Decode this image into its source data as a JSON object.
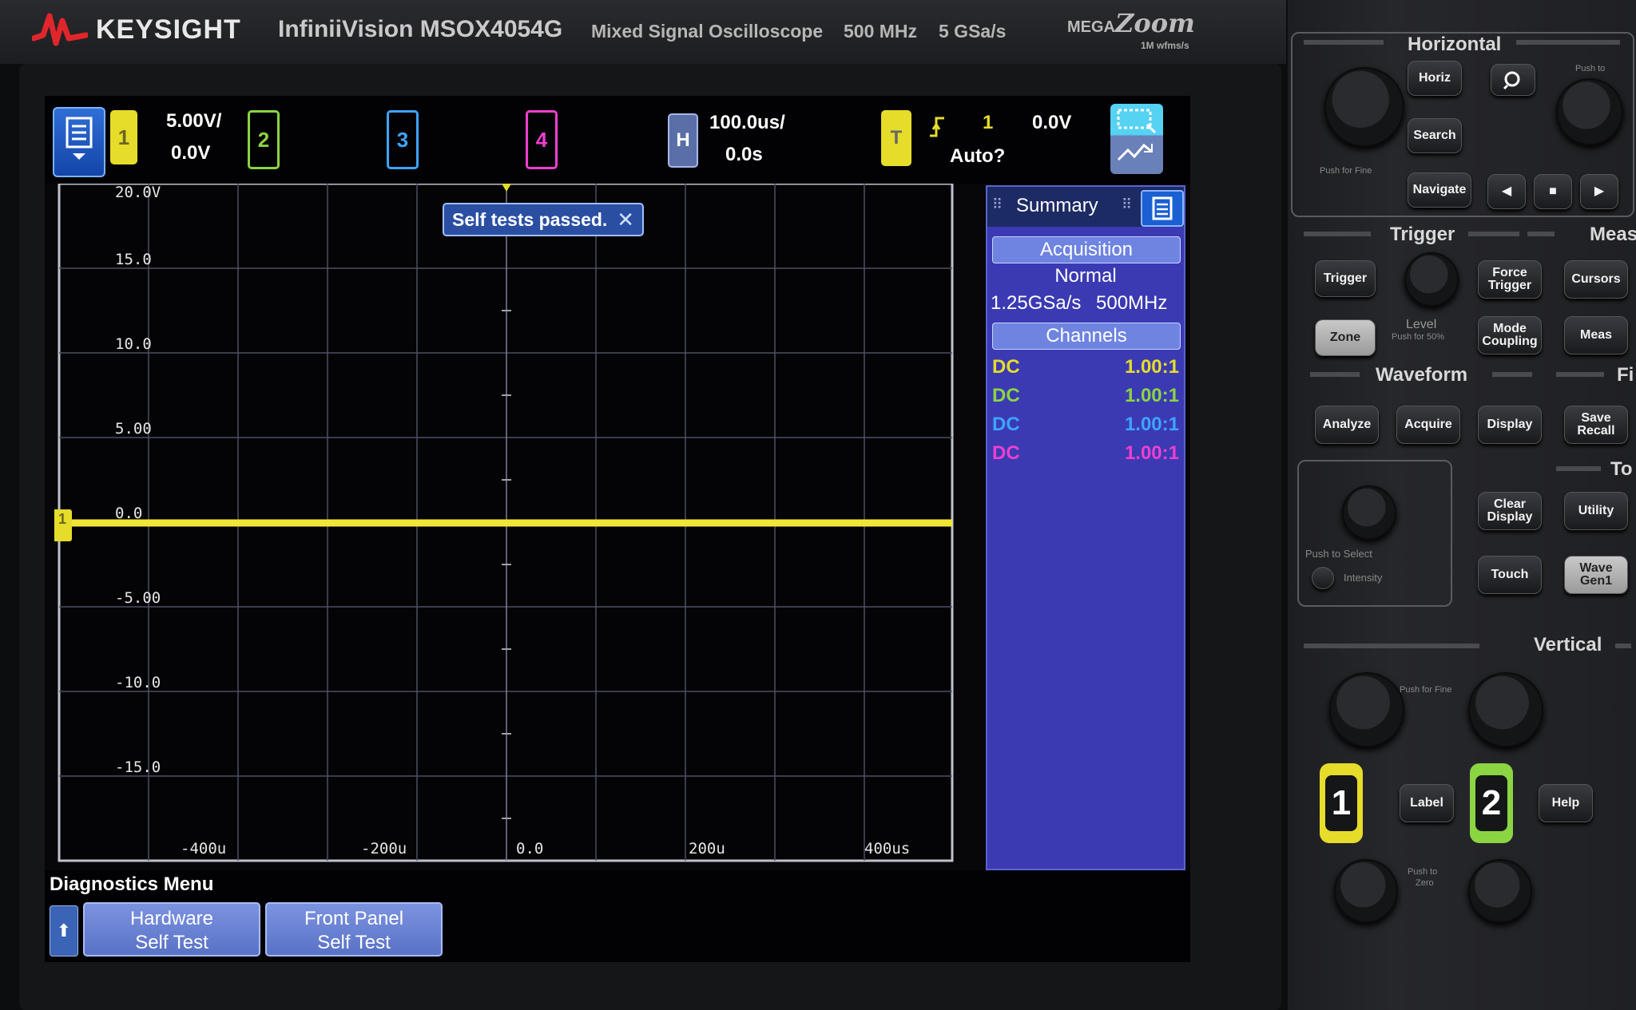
{
  "header": {
    "brand": "KEYSIGHT",
    "model": "InfiniiVision MSOX4054G",
    "description": "Mixed Signal Oscilloscope",
    "bandwidth": "500 MHz",
    "sample_rate": "5 GSa/s",
    "megazoom_a": "MEGA",
    "megazoom_b": "Zoom",
    "megazoom_c": "1M wfms/s"
  },
  "status_bar": {
    "ch1": {
      "label": "1",
      "scale": "5.00V/",
      "offset": "0.0V",
      "color": "#e6dc2a"
    },
    "ch2": {
      "label": "2",
      "color": "#8bd442"
    },
    "ch3": {
      "label": "3",
      "color": "#3ea4ff"
    },
    "ch4": {
      "label": "4",
      "color": "#ee3fd0"
    },
    "horizontal": {
      "label": "H",
      "scale": "100.0us/",
      "delay": "0.0s"
    },
    "trigger": {
      "label": "T",
      "slope_icon": "rising-edge-icon",
      "source": "1",
      "level": "0.0V",
      "mode": "Auto?"
    }
  },
  "graticule": {
    "y_labels": [
      "20.0V",
      "15.0",
      "10.0",
      "5.00",
      "0.0",
      "-5.00",
      "-10.0",
      "-15.0"
    ],
    "x_labels": [
      "-400u",
      "-200u",
      "0.0",
      "200u",
      "400us"
    ],
    "ground_marker": "1"
  },
  "toast": {
    "text": "Self tests passed.",
    "close": "✕"
  },
  "summary": {
    "title": "Summary",
    "acquisition_title": "Acquisition",
    "mode": "Normal",
    "rate": "1.25GSa/s",
    "bandwidth": "500MHz",
    "channels_title": "Channels",
    "channels": [
      {
        "coupling": "DC",
        "probe": "1.00:1",
        "color": "#e6dc2a"
      },
      {
        "coupling": "DC",
        "probe": "1.00:1",
        "color": "#8bd442"
      },
      {
        "coupling": "DC",
        "probe": "1.00:1",
        "color": "#3ea4ff"
      },
      {
        "coupling": "DC",
        "probe": "1.00:1",
        "color": "#ee3fd0"
      }
    ]
  },
  "menu": {
    "title": "Diagnostics Menu",
    "softkeys": [
      {
        "line1": "Hardware",
        "line2": "Self Test"
      },
      {
        "line1": "Front Panel",
        "line2": "Self Test"
      }
    ]
  },
  "panel": {
    "horizontal_title": "Horizontal",
    "horiz": "Horiz",
    "search": "Search",
    "navigate": "Navigate",
    "push_fine": "Push for Fine",
    "push_to": "Push to",
    "trigger_title": "Trigger",
    "meas_title": "Meas",
    "trigger_btn": "Trigger",
    "force_l1": "Force",
    "force_l2": "Trigger",
    "level": "Level",
    "push_50": "Push for 50%",
    "zone": "Zone",
    "mode_l1": "Mode",
    "mode_l2": "Coupling",
    "cursors": "Cursors",
    "meas": "Meas",
    "waveform_title": "Waveform",
    "file_title": "Fi",
    "analyze": "Analyze",
    "acquire": "Acquire",
    "display": "Display",
    "save_l1": "Save",
    "save_l2": "Recall",
    "tools_title": "To",
    "clear_l1": "Clear",
    "clear_l2": "Display",
    "utility": "Utility",
    "push_select": "Push to Select",
    "intensity": "Intensity",
    "touch": "Touch",
    "wave_l1": "Wave",
    "wave_l2": "Gen1",
    "vertical_title": "Vertical",
    "ch1_label": "1",
    "ch2_label": "2",
    "label_btn": "Label",
    "help_btn": "Help",
    "push_zero_l1": "Push to",
    "push_zero_l2": "Zero"
  }
}
